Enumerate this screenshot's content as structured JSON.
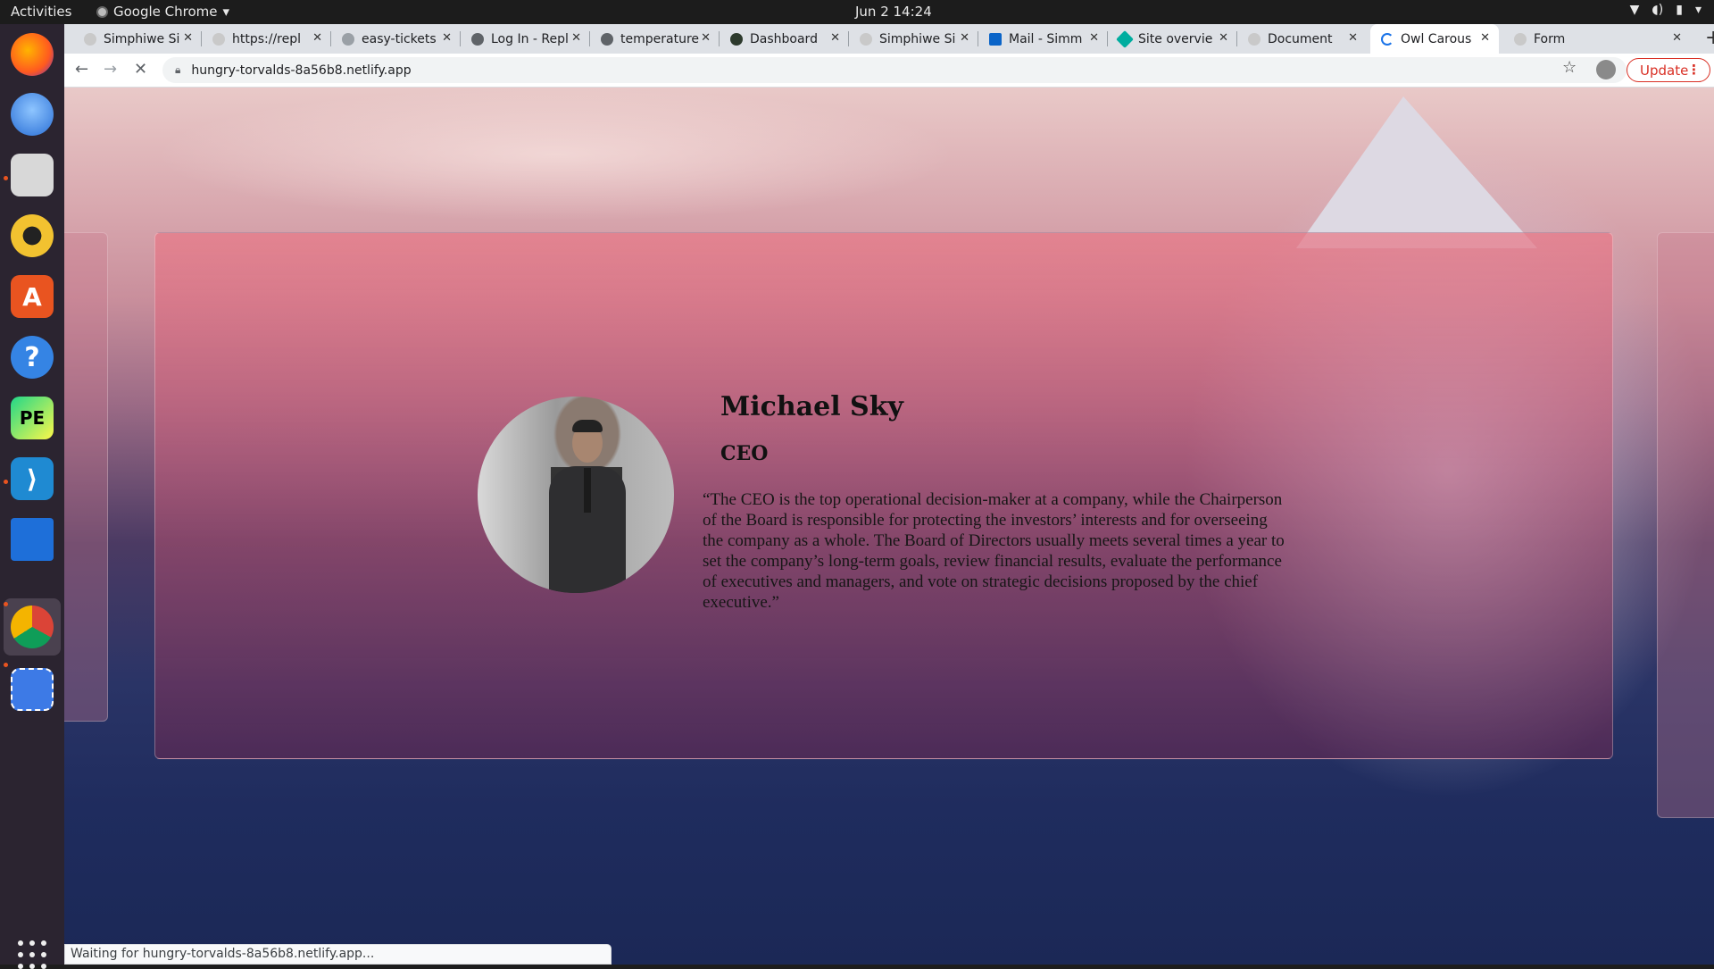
{
  "topbar": {
    "activities": "Activities",
    "app_menu": "Google Chrome",
    "clock": "Jun 2  14:24"
  },
  "dock": {
    "items": [
      "firefox-icon",
      "thunderbird-icon",
      "files-icon",
      "rhythmbox-icon",
      "software-center-icon",
      "help-icon",
      "pycharm-icon",
      "vscode-icon",
      "libreoffice-writer-icon",
      "chrome-icon",
      "screenshot-icon"
    ],
    "pycharm_label": "PE"
  },
  "tabs": [
    {
      "title": "Simphiwe Si"
    },
    {
      "title": "https://repl"
    },
    {
      "title": "easy-tickets"
    },
    {
      "title": "Log In - Repl"
    },
    {
      "title": "temperature"
    },
    {
      "title": "Dashboard"
    },
    {
      "title": "Simphiwe Si"
    },
    {
      "title": "Mail - Simm"
    },
    {
      "title": "Site overvie"
    },
    {
      "title": "Document"
    },
    {
      "title": "Owl Carous"
    },
    {
      "title": "Form"
    }
  ],
  "toolbar": {
    "url": "hungry-torvalds-8a56b8.netlify.app",
    "update_label": "Update"
  },
  "testimonial": {
    "name": "Michael Sky",
    "role": "CEO",
    "quote": "“The CEO is the top operational decision-maker at a company, while the Chairperson of the Board is responsible for protecting the investors’ interests and for overseeing the company as a whole. The Board of Directors usually meets several times a year to set the company’s long-term goals, review financial results, evaluate the performance of executives and managers, and vote on strategic decisions proposed by the chief executive.”"
  },
  "status_bar": {
    "text": "Waiting for hungry-torvalds-8a56b8.netlify.app..."
  }
}
